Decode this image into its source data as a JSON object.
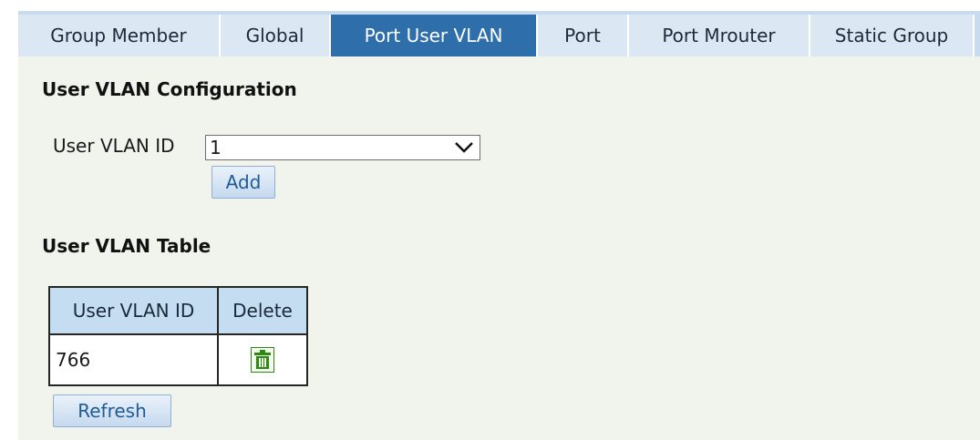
{
  "tabs": [
    {
      "label": "Group Member",
      "active": false
    },
    {
      "label": "Global",
      "active": false
    },
    {
      "label": "Port User VLAN",
      "active": true
    },
    {
      "label": "Port",
      "active": false
    },
    {
      "label": "Port Mrouter",
      "active": false
    },
    {
      "label": "Static Group",
      "active": false
    }
  ],
  "config": {
    "title": "User VLAN Configuration",
    "vlan_label": "User VLAN ID",
    "vlan_value": "1",
    "add_label": "Add"
  },
  "table": {
    "title": "User VLAN Table",
    "headers": [
      "User VLAN ID",
      "Delete"
    ],
    "rows": [
      {
        "vlan_id": "766",
        "delete_icon": "trash-icon"
      }
    ]
  },
  "refresh_label": "Refresh",
  "colors": {
    "tab_active": "#2e6eaa",
    "tab_bg": "#dbe8f4",
    "content_bg": "#f1f4ec",
    "table_header_bg": "#c5ddf1",
    "trash_green": "#2c8a10"
  }
}
